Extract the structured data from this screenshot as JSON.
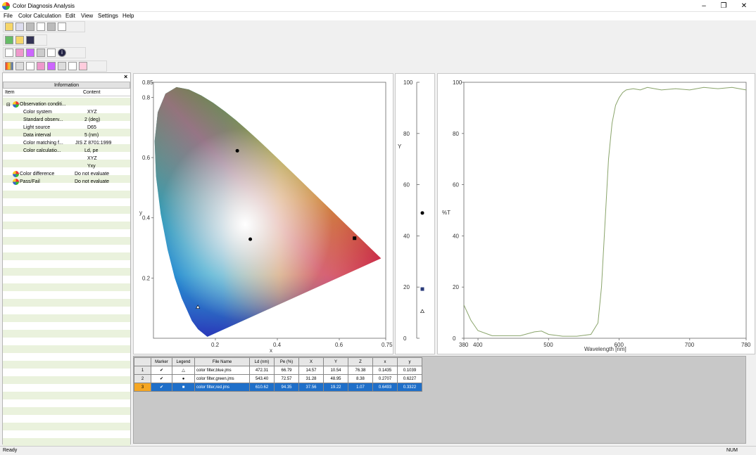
{
  "window": {
    "title": "Color Diagnosis Analysis",
    "minimize": "–",
    "restore": "❐",
    "close": "✕"
  },
  "menu": [
    "File",
    "Color Calculation",
    "Edit",
    "View",
    "Settings",
    "Help"
  ],
  "left_panel": {
    "close_glyph": "×",
    "header": "Information",
    "col_item": "Item",
    "col_content": "Content",
    "rows": [
      {
        "item": "Observation conditi...",
        "content": ""
      },
      {
        "item": "Color system",
        "content": "XYZ"
      },
      {
        "item": "Standard observ...",
        "content": "2 (deg)"
      },
      {
        "item": "Light source",
        "content": "D65"
      },
      {
        "item": "Data interval",
        "content": "5 (nm)"
      },
      {
        "item": "Color matching f...",
        "content": "JIS Z 8701:1999"
      },
      {
        "item": "Color calculatio...",
        "content": "Ld, pe"
      },
      {
        "item": "",
        "content": "XYZ"
      },
      {
        "item": "",
        "content": "Yxy"
      },
      {
        "item": "Color difference",
        "content": "Do not evaluate"
      },
      {
        "item": "Pass/Fail",
        "content": "Do not evaluate"
      }
    ]
  },
  "colors": {
    "accent": "#1f6fc9",
    "selected_rownum": "#f5a623",
    "stripe": "#eaf2dd",
    "spectrum_line": "#8aa46b"
  },
  "chromaticity": {
    "xlabel": "x",
    "ylabel": "y",
    "x_ticks": [
      "0.2",
      "0.4",
      "0.6",
      "0.75"
    ],
    "y_ticks": [
      "0.2",
      "0.4",
      "0.6",
      "0.8",
      "0.85"
    ],
    "points": [
      {
        "marker": "triangle",
        "x": 0.1435,
        "y": 0.1039
      },
      {
        "marker": "circle",
        "x": 0.2707,
        "y": 0.6227
      },
      {
        "marker": "square",
        "x": 0.6493,
        "y": 0.3322
      },
      {
        "marker": "circle",
        "x": 0.3127,
        "y": 0.329
      }
    ]
  },
  "y_bar": {
    "label": "Y",
    "ticks": [
      "0",
      "20",
      "40",
      "60",
      "80",
      "100"
    ],
    "points": [
      {
        "marker": "circle",
        "value": 48.95
      },
      {
        "marker": "square",
        "value": 19.22
      },
      {
        "marker": "triangle",
        "value": 10.54
      }
    ]
  },
  "chart_data": {
    "type": "line",
    "xlabel": "Wavelength [nm]",
    "ylabel": "%T",
    "xlim": [
      380,
      780
    ],
    "ylim": [
      0,
      100
    ],
    "x_ticks": [
      "380",
      "400",
      "500",
      "600",
      "700",
      "780"
    ],
    "y_ticks": [
      "0",
      "20",
      "40",
      "60",
      "80",
      "100"
    ],
    "series": [
      {
        "x": [
          380,
          390,
          400,
          420,
          440,
          460,
          480,
          490,
          500,
          520,
          540,
          560,
          570,
          575,
          580,
          585,
          590,
          595,
          600,
          605,
          610,
          620,
          630,
          640,
          660,
          680,
          700,
          720,
          740,
          760,
          780
        ],
        "y": [
          13,
          7,
          3,
          1,
          1,
          1,
          2.5,
          2.8,
          1.5,
          0.8,
          0.8,
          1.5,
          6,
          20,
          45,
          70,
          84,
          91,
          94,
          96,
          97,
          97.5,
          97,
          98,
          97,
          97.5,
          97,
          98,
          97.5,
          98,
          97
        ]
      }
    ]
  },
  "table": {
    "headers": [
      "",
      "Marker",
      "Legend",
      "File Name",
      "Ld (nm)",
      "Pe (%)",
      "X",
      "Y",
      "Z",
      "x",
      "y"
    ],
    "rows": [
      [
        "1",
        "✔",
        "△",
        "color filter,blue.jms",
        "472.31",
        "66.79",
        "14.57",
        "10.54",
        "76.38",
        "0.1435",
        "0.1039"
      ],
      [
        "2",
        "✔",
        "●",
        "color filter,green.jms",
        "543.40",
        "72.57",
        "31.28",
        "48.95",
        "8.38",
        "0.2707",
        "0.6227"
      ],
      [
        "3",
        "✔",
        "■",
        "color filter,red.jms",
        "610.62",
        "94.35",
        "37.56",
        "19.22",
        "1.07",
        "0.6493",
        "0.3322"
      ]
    ],
    "selected_row": 2
  },
  "status": {
    "left": "Ready",
    "right": "NUM"
  }
}
